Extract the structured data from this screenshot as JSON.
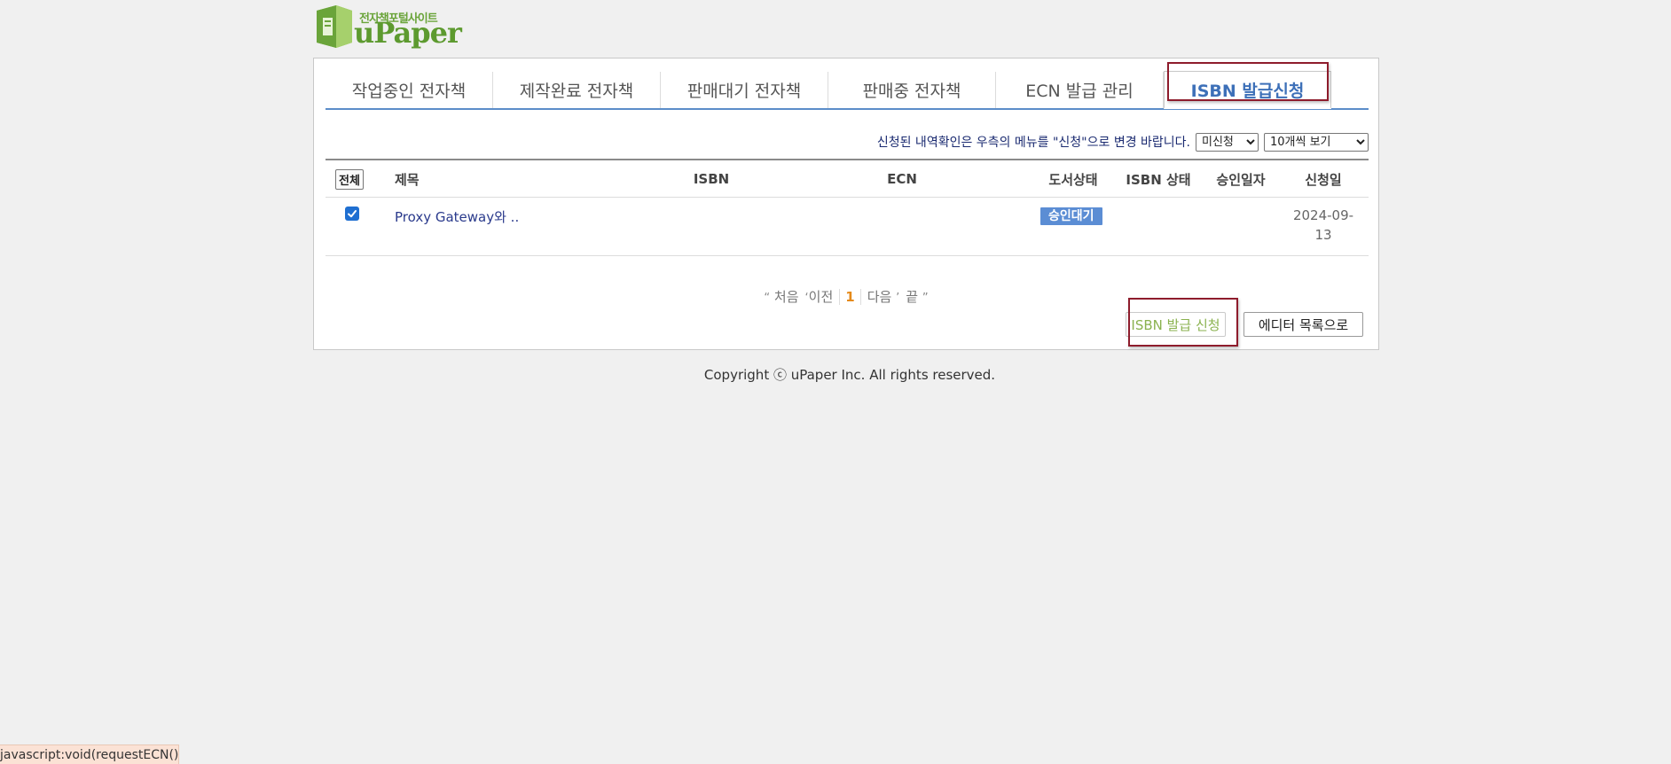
{
  "logo": {
    "subtitle": "전자책포털사이트",
    "name": "uPaper"
  },
  "tabs": [
    {
      "label": "작업중인 전자책",
      "active": false
    },
    {
      "label": "제작완료 전자책",
      "active": false
    },
    {
      "label": "판매대기 전자책",
      "active": false
    },
    {
      "label": "판매중 전자책",
      "active": false
    },
    {
      "label": "ECN 발급 관리",
      "active": false
    },
    {
      "label": "ISBN 발급신청",
      "active": true
    }
  ],
  "notice": {
    "text": "신청된 내역확인은 우측의 메뉴를 \"신청\"으로 변경 바랍니다.",
    "status_select": "미신청",
    "page_size_select": "10개씩 보기"
  },
  "table": {
    "select_all_label": "전체",
    "headers": {
      "title": "제목",
      "isbn": "ISBN",
      "ecn": "ECN",
      "book_status": "도서상태",
      "isbn_status": "ISBN 상태",
      "approval_date": "승인일자",
      "request_date": "신청일"
    },
    "rows": [
      {
        "checked": true,
        "title": "Proxy Gateway와 ..",
        "isbn": "",
        "ecn": "",
        "book_status": "승인대기",
        "isbn_status": "",
        "approval_date": "",
        "request_date": "2024-09-13"
      }
    ]
  },
  "pagination": {
    "first": "처음",
    "prev": "이전",
    "current": "1",
    "next": "다음",
    "last": "끝"
  },
  "buttons": {
    "isbn_request": "ISBN 발급 신청",
    "editor_list": "에디터 목록으로"
  },
  "footer": {
    "copyright": "Copyright ⓒ uPaper Inc. All rights reserved."
  },
  "status_bar": {
    "url": "javascript:void(requestECN())"
  },
  "colors": {
    "accent": "#3d70b8",
    "highlight_box": "#8e1c2c",
    "badge": "#5b8dd4",
    "current_page": "#e58a1a",
    "logo_green": "#5d9a2f"
  }
}
